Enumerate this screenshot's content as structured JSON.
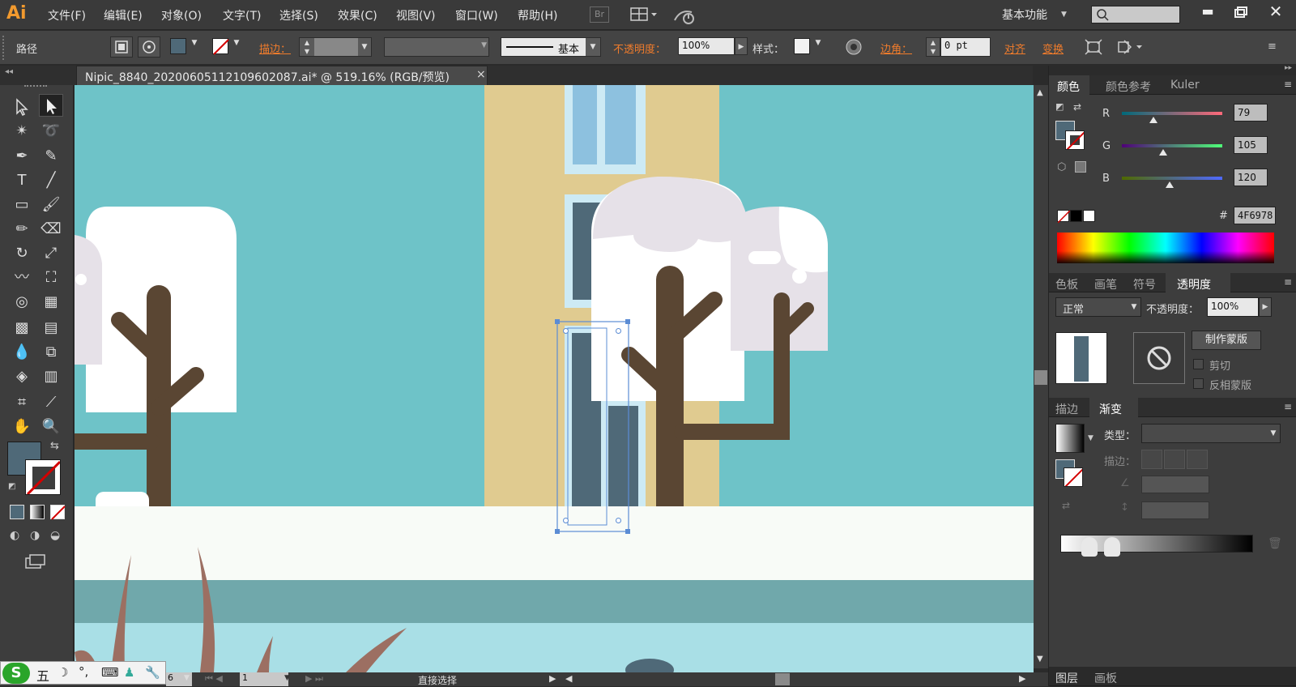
{
  "app": {
    "logo": "Ai",
    "workspace": "基本功能",
    "bridge_label": "Br"
  },
  "menu": {
    "items": [
      "文件(F)",
      "编辑(E)",
      "对象(O)",
      "文字(T)",
      "选择(S)",
      "效果(C)",
      "视图(V)",
      "窗口(W)",
      "帮助(H)"
    ]
  },
  "controlbar": {
    "selection_type": "路径",
    "stroke_label": "描边：",
    "stroke_profile": "基本",
    "opacity_label": "不透明度：",
    "opacity_value": "100%",
    "style_label": "样式：",
    "corner_label": "边角：",
    "corner_value": "0 pt",
    "align_label": "对齐",
    "transform_label": "变换"
  },
  "document": {
    "tab_title": "Nipic_8840_20200605112109602087.ai* @ 519.16% (RGB/预览)",
    "close_glyph": "×"
  },
  "color_panel": {
    "tabs": [
      "颜色",
      "颜色参考",
      "Kuler"
    ],
    "r_label": "R",
    "g_label": "G",
    "b_label": "B",
    "r_value": "79",
    "g_value": "105",
    "b_value": "120",
    "hash_label": "#",
    "hex_value": "4F6978",
    "fill_color": "#4f6978"
  },
  "transparency_panel": {
    "tabs": [
      "色板",
      "画笔",
      "符号",
      "透明度"
    ],
    "blend_mode": "正常",
    "opacity_label": "不透明度：",
    "opacity_value": "100%",
    "make_mask_button": "制作蒙版",
    "clip_label": "剪切",
    "invert_label": "反相蒙版"
  },
  "gradient_panel": {
    "tabs": [
      "描边",
      "渐变"
    ],
    "type_label": "类型：",
    "stroke_label": "描边："
  },
  "bottom_tabs": [
    "图层",
    "画板"
  ],
  "statusbar": {
    "zoom_fragment": "6",
    "artboard_number": "1",
    "tool_name": "直接选择"
  },
  "ime": {
    "mode": "五"
  },
  "colors": {
    "sky": "#6ec3c8",
    "wall": "#e0cb90",
    "window_dark": "#4f6978",
    "window_light": "#8dc1df",
    "window_frame": "#cdeaf4",
    "snow": "#f8fbf7",
    "tree_trunk": "#5a4633",
    "cloud": "#e6e1e8",
    "water_dark": "#70a8ab",
    "water_light": "#a9dfe6",
    "grass": "#9c6f62",
    "selection": "#5b8cd4",
    "accent_orange": "#f07c2c"
  }
}
